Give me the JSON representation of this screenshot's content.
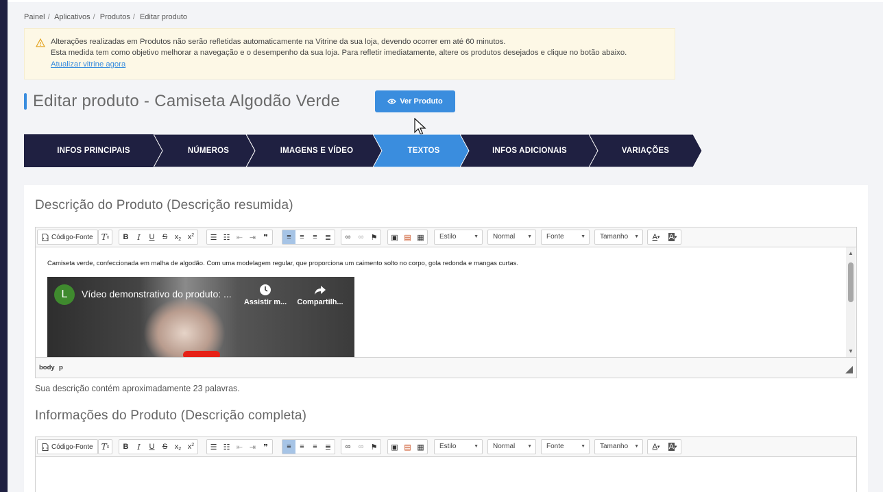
{
  "breadcrumb": {
    "items": [
      "Painel",
      "Aplicativos",
      "Produtos",
      "Editar produto"
    ],
    "separator": "/"
  },
  "alert": {
    "line1": "Alterações realizadas em Produtos não serão refletidas automaticamente na Vitrine da sua loja, devendo ocorrer em até 60 minutos.",
    "line2": "Esta medida tem como objetivo melhorar a navegação e o desempenho da sua loja. Para refletir imediatamente, altere os produtos desejados e clique no botão abaixo.",
    "link": "Atualizar vitrine agora"
  },
  "header": {
    "title": "Editar produto - Camiseta Algodão Verde",
    "view_button": "Ver Produto"
  },
  "tabs": [
    {
      "label": "INFOS PRINCIPAIS",
      "active": false
    },
    {
      "label": "NÚMEROS",
      "active": false
    },
    {
      "label": "IMAGENS E VÍDEO",
      "active": false
    },
    {
      "label": "TEXTOS",
      "active": true
    },
    {
      "label": "INFOS ADICIONAIS",
      "active": false
    },
    {
      "label": "VARIAÇÕES",
      "active": false
    }
  ],
  "toolbar": {
    "source_label": "Código-Fonte",
    "style_combo": "Estilo",
    "format_combo": "Normal",
    "font_combo": "Fonte",
    "size_combo": "Tamanho"
  },
  "short_desc": {
    "title": "Descrição do Produto (Descrição resumida)",
    "text": "Camiseta verde, confeccionada em malha de algodão. Com uma modelagem regular, que proporciona um caimento solto no corpo, gola redonda e mangas curtas.",
    "video": {
      "avatar_letter": "L",
      "title": "Vídeo demonstrativo do produto: ...",
      "watch_later": "Assistir m...",
      "share": "Compartilh..."
    },
    "path_body": "body",
    "path_p": "p",
    "word_count": "Sua descrição contém aproximadamente 23 palavras."
  },
  "full_desc": {
    "title": "Informações do Produto (Descrição completa)"
  },
  "colors": {
    "nav_dark": "#1f2041",
    "accent": "#3a8dde",
    "alert_bg": "#fdf8e6"
  }
}
